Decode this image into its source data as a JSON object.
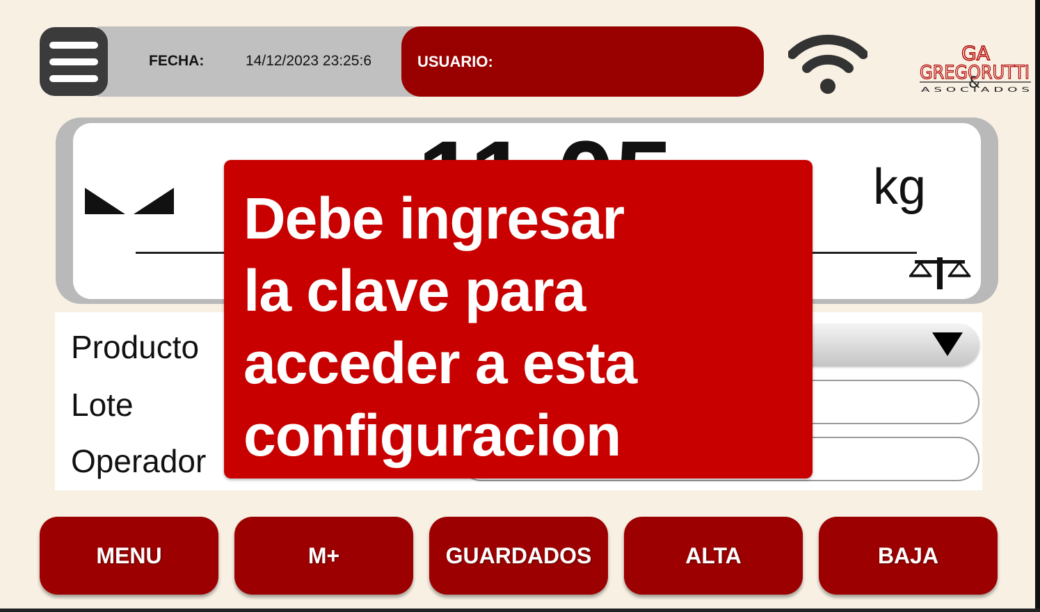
{
  "header": {
    "fecha_label": "FECHA:",
    "fecha_value": "14/12/2023 23:25:6",
    "usuario_label": "USUARIO:"
  },
  "logo": {
    "initials": "GA",
    "name": "GREGORUTTI",
    "ampersand": "&",
    "subtitle": "A S O C I A D O S"
  },
  "display": {
    "weight": "11.05",
    "unit": "kg"
  },
  "form": {
    "producto_label": "Producto",
    "lote_label": "Lote",
    "operador_label": "Operador",
    "producto_value": "",
    "lote_value": "",
    "operador_value": ""
  },
  "alert": {
    "lines": [
      "Debe ingresar",
      "la clave para",
      "acceder a esta",
      "configuracion"
    ]
  },
  "buttons": {
    "menu": "MENU",
    "mplus": "M+",
    "guardados": "GUARDADOS",
    "alta": "ALTA",
    "baja": "BAJA"
  },
  "icons": {
    "menu": "hamburger-icon",
    "wifi": "wifi-icon",
    "zero": "zero-indicator-icon",
    "scale": "balance-scale-icon",
    "dropdown": "triangle-down-icon"
  },
  "colors": {
    "background": "#f8f0e3",
    "accent_dark_red": "#990000",
    "alert_red": "#c80000",
    "header_gray": "#c0c0c0"
  }
}
